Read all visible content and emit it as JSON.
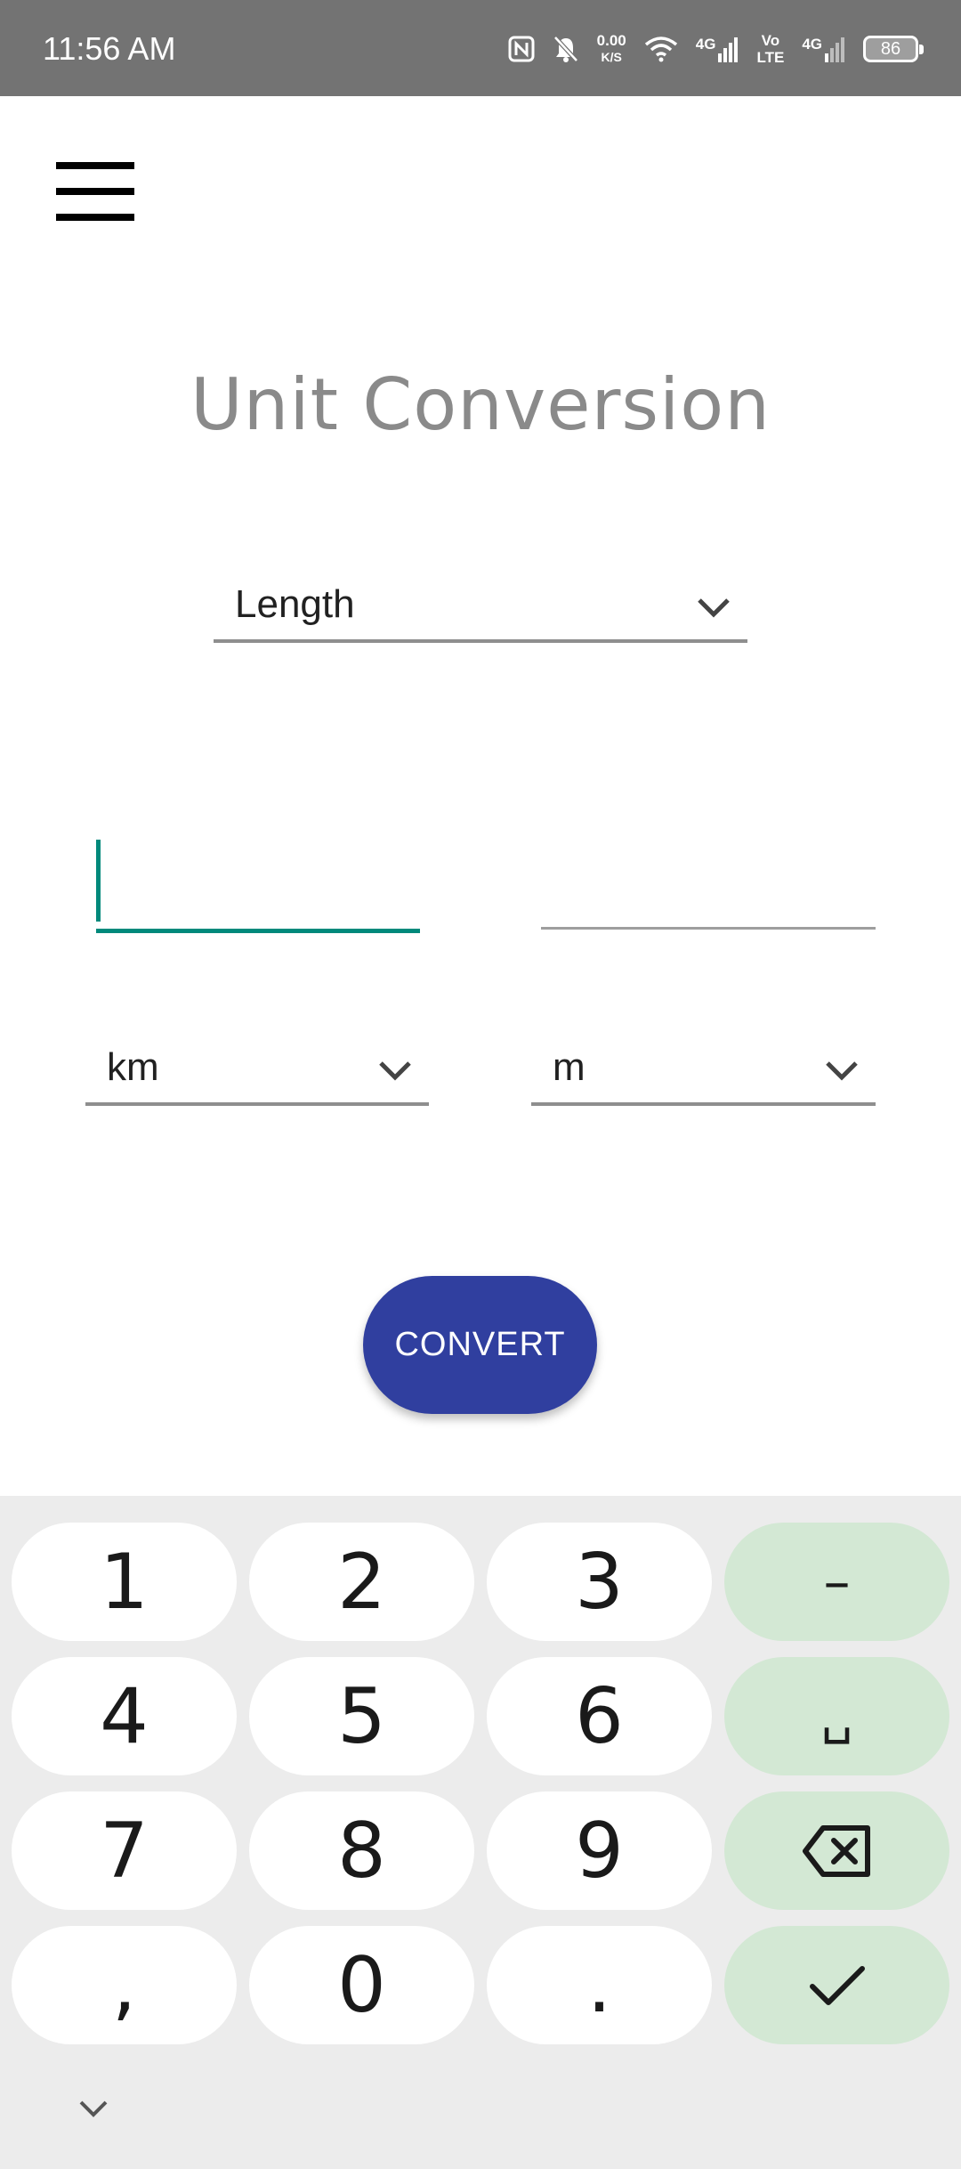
{
  "status_bar": {
    "time": "11:56 AM",
    "net_speed_value": "0.00",
    "net_speed_unit": "K/S",
    "network_1": "4G",
    "volte_top": "Vo",
    "volte_bottom": "LTE",
    "network_2": "4G",
    "battery": "86",
    "icons": [
      "nfc-icon",
      "bell-off-icon",
      "wifi-icon",
      "signal-icon",
      "signal-weak-icon",
      "battery-icon"
    ]
  },
  "app": {
    "title": "Unit Conversion",
    "category": {
      "selected": "Length"
    },
    "from_input": {
      "value": "",
      "placeholder": ""
    },
    "to_output": {
      "value": "",
      "placeholder": ""
    },
    "from_unit": {
      "selected": "km"
    },
    "to_unit": {
      "selected": "m"
    },
    "convert_label": "CONVERT"
  },
  "keyboard": {
    "keys": [
      {
        "label": "1"
      },
      {
        "label": "2"
      },
      {
        "label": "3"
      },
      {
        "label": "–"
      },
      {
        "label": "4"
      },
      {
        "label": "5"
      },
      {
        "label": "6"
      },
      {
        "label": "␣"
      },
      {
        "label": "7"
      },
      {
        "label": "8"
      },
      {
        "label": "9"
      },
      {
        "label": ""
      },
      {
        "label": ","
      },
      {
        "label": "0"
      },
      {
        "label": "."
      },
      {
        "label": ""
      }
    ],
    "function_key_color": "#d3e8d4",
    "accent": "#00897b",
    "button_color": "#303f9f"
  }
}
